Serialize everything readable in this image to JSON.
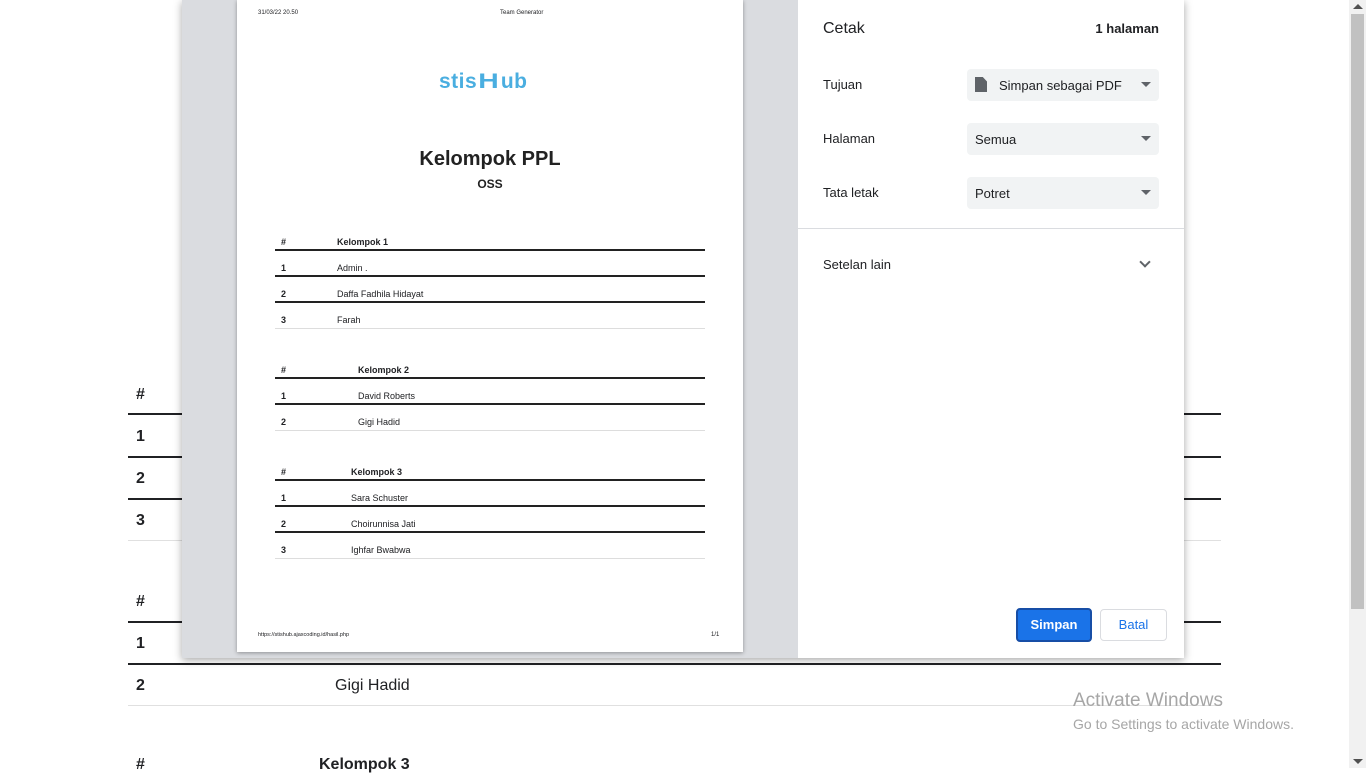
{
  "background": {
    "hash": "#",
    "rows_group2": [
      {
        "no": "1",
        "name": ""
      },
      {
        "no": "2",
        "name": ""
      },
      {
        "no": "3",
        "name": ""
      }
    ],
    "group3_hash": "#",
    "rows_group3": [
      {
        "no": "1",
        "name": ""
      },
      {
        "no": "2",
        "name": "Gigi Hadid"
      }
    ],
    "group4_hash": "#",
    "group4_title": "Kelompok 3"
  },
  "watermark": {
    "line1": "Activate Windows",
    "line2": "Go to Settings to activate Windows."
  },
  "preview": {
    "header_date": "31/03/22 20.50",
    "header_title": "Team Generator",
    "logo_left": "stis",
    "logo_mid": "H",
    "logo_right": "ub",
    "doc_title": "Kelompok PPL",
    "doc_subtitle": "OSS",
    "groups": [
      {
        "hash": "#",
        "title": "Kelompok 1",
        "members": [
          {
            "no": "1",
            "name": "Admin ."
          },
          {
            "no": "2",
            "name": "Daffa Fadhila Hidayat"
          },
          {
            "no": "3",
            "name": "Farah"
          }
        ]
      },
      {
        "hash": "#",
        "title": "Kelompok 2",
        "members": [
          {
            "no": "1",
            "name": "David Roberts"
          },
          {
            "no": "2",
            "name": "Gigi Hadid"
          }
        ]
      },
      {
        "hash": "#",
        "title": "Kelompok 3",
        "members": [
          {
            "no": "1",
            "name": "Sara Schuster"
          },
          {
            "no": "2",
            "name": "Choirunnisa Jati"
          },
          {
            "no": "3",
            "name": "Ighfar Bwabwa"
          }
        ]
      }
    ],
    "footer_url": "https://stishub.ajaxcoding.id/hasil.php",
    "footer_page": "1/1"
  },
  "settings": {
    "title": "Cetak",
    "page_count": "1 halaman",
    "destination_label": "Tujuan",
    "destination_value": "Simpan sebagai PDF",
    "pages_label": "Halaman",
    "pages_value": "Semua",
    "layout_label": "Tata letak",
    "layout_value": "Potret",
    "more_settings": "Setelan lain",
    "save_label": "Simpan",
    "cancel_label": "Batal",
    "accent": "#1a73e8"
  }
}
